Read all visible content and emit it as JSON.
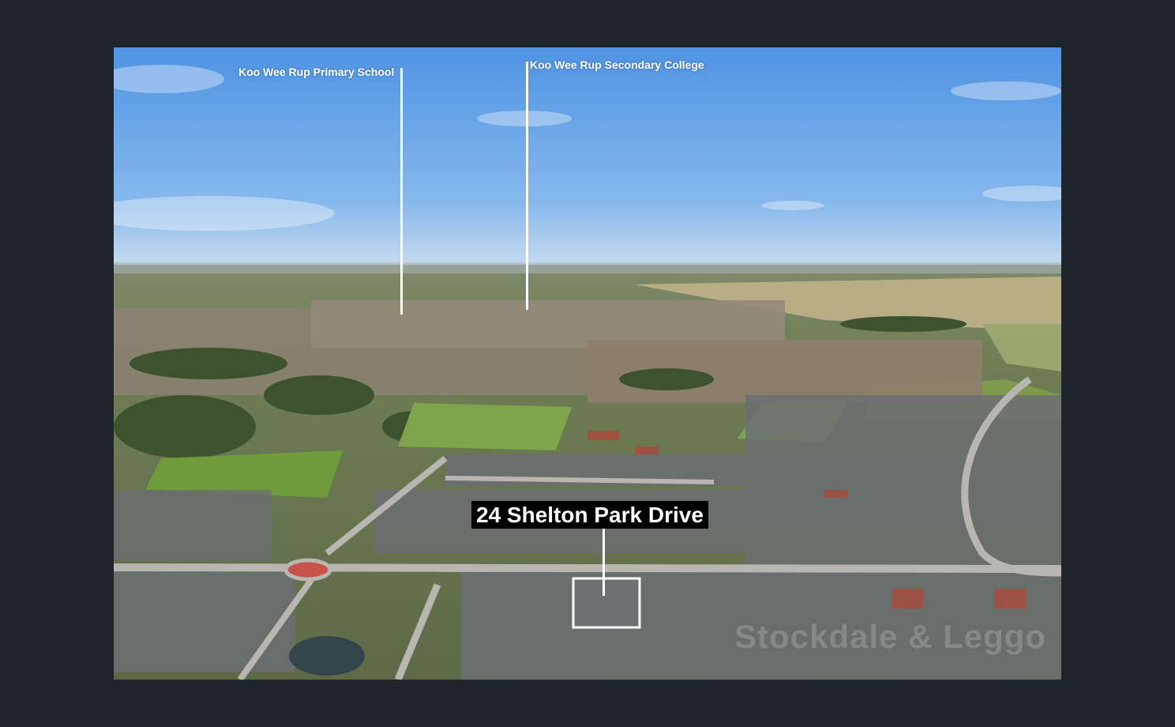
{
  "annotations": {
    "primary_school": "Koo Wee Rup Primary School",
    "secondary_college": "Koo Wee Rup Secondary College",
    "address": "24 Shelton Park Drive"
  },
  "watermark": "Stockdale & Leggo",
  "colors": {
    "frame": "#1f252d",
    "sky": "#5e9ee6",
    "label_bg": "#000000",
    "label_text": "#ffffff"
  }
}
